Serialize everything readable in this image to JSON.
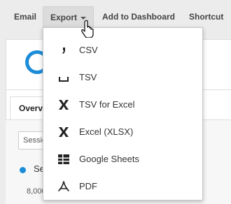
{
  "toolbar": {
    "email_label": "Email",
    "export_label": "Export",
    "dashboard_label": "Add to Dashboard",
    "shortcut_label": "Shortcut"
  },
  "export_menu": {
    "items": [
      {
        "label": "CSV",
        "icon": "comma-icon"
      },
      {
        "label": "TSV",
        "icon": "tab-space-icon"
      },
      {
        "label": "TSV for Excel",
        "icon": "excel-x-icon"
      },
      {
        "label": "Excel (XLSX)",
        "icon": "excel-x-icon"
      },
      {
        "label": "Google Sheets",
        "icon": "sheets-grid-icon"
      },
      {
        "label": "PDF",
        "icon": "pdf-icon"
      }
    ]
  },
  "background": {
    "tab_overview": "Overview",
    "metric_select": "Sessions",
    "legend_label": "Sessions",
    "axis_value": "8,000"
  },
  "colors": {
    "accent": "#1a8cd8",
    "toolbar_bg": "#ececec",
    "active_button_bg": "#dcdcdc"
  }
}
